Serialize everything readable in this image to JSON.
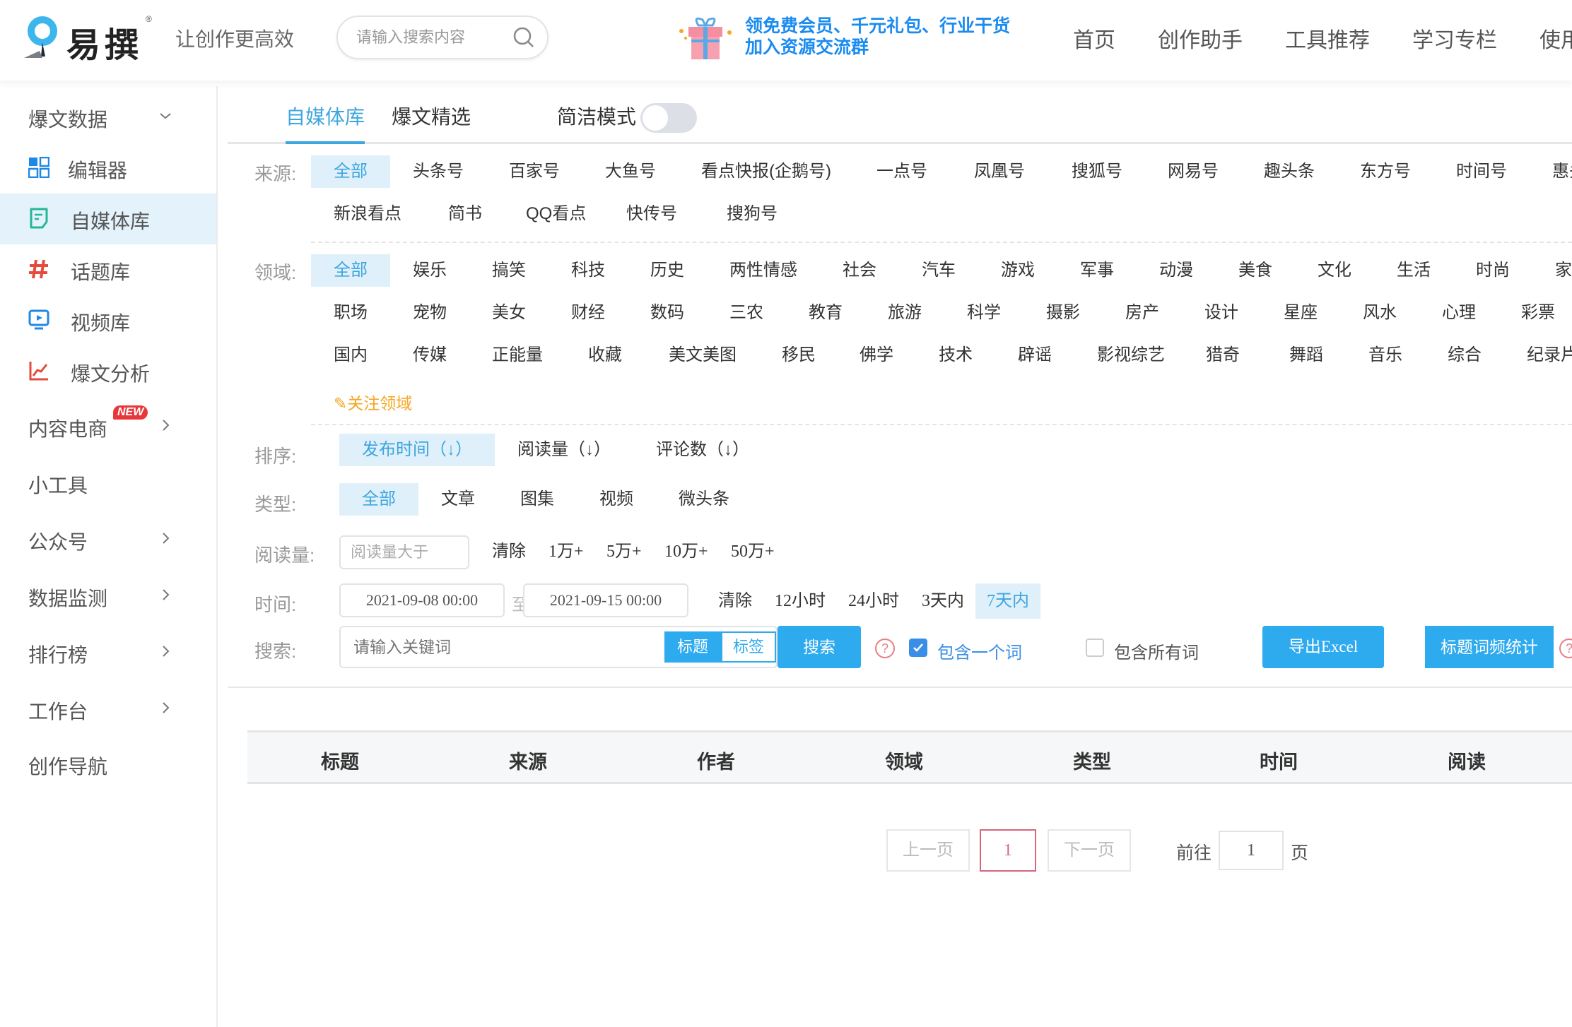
{
  "header": {
    "logo_text": "易撰",
    "logo_reg": "®",
    "slogan": "让创作更高效",
    "search_placeholder": "请输入搜索内容",
    "promo_line1": "领免费会员、千元礼包、行业干货",
    "promo_line2": "加入资源交流群",
    "nav": [
      "首页",
      "创作助手",
      "工具推荐",
      "学习专栏",
      "使用"
    ]
  },
  "sidebar": {
    "section_title": "爆文数据",
    "items": [
      {
        "label": "编辑器",
        "icon": "grid-icon"
      },
      {
        "label": "自媒体库",
        "icon": "note-icon",
        "active": true
      },
      {
        "label": "话题库",
        "icon": "hashtag-icon"
      },
      {
        "label": "视频库",
        "icon": "video-icon"
      },
      {
        "label": "爆文分析",
        "icon": "chart-line-icon"
      }
    ],
    "groups": [
      {
        "label": "内容电商",
        "badge": "NEW",
        "has_arrow": true
      },
      {
        "label": "小工具",
        "has_arrow": false
      },
      {
        "label": "公众号",
        "has_arrow": true
      },
      {
        "label": "数据监测",
        "has_arrow": true
      },
      {
        "label": "排行榜",
        "has_arrow": true
      },
      {
        "label": "工作台",
        "has_arrow": true
      },
      {
        "label": "创作导航",
        "has_arrow": false
      }
    ]
  },
  "tabs": {
    "items": [
      "自媒体库",
      "爆文精选"
    ],
    "active": "自媒体库",
    "simple_mode_label": "简洁模式",
    "simple_mode_on": false
  },
  "filters": {
    "source": {
      "label": "来源:",
      "selected": "全部",
      "row1": [
        "全部",
        "头条号",
        "百家号",
        "大鱼号",
        "看点快报(企鹅号)",
        "一点号",
        "凤凰号",
        "搜狐号",
        "网易号",
        "趣头条",
        "东方号",
        "时间号",
        "惠头"
      ],
      "row2": [
        "新浪看点",
        "简书",
        "QQ看点",
        "快传号",
        "搜狗号"
      ]
    },
    "domain": {
      "label": "领域:",
      "selected": "全部",
      "row1": [
        "全部",
        "娱乐",
        "搞笑",
        "科技",
        "历史",
        "两性情感",
        "社会",
        "汽车",
        "游戏",
        "军事",
        "动漫",
        "美食",
        "文化",
        "生活",
        "时尚",
        "家"
      ],
      "row2": [
        "职场",
        "宠物",
        "美女",
        "财经",
        "数码",
        "三农",
        "教育",
        "旅游",
        "科学",
        "摄影",
        "房产",
        "设计",
        "星座",
        "风水",
        "心理",
        "彩票"
      ],
      "row3": [
        "国内",
        "传媒",
        "正能量",
        "收藏",
        "美文美图",
        "移民",
        "佛学",
        "技术",
        "辟谣",
        "影视综艺",
        "猎奇",
        "舞蹈",
        "音乐",
        "综合",
        "纪录片"
      ],
      "follow_label": "关注领域"
    },
    "sort": {
      "label": "排序:",
      "options": [
        "发布时间（↓）",
        "阅读量（↓）",
        "评论数（↓）"
      ],
      "selected": "发布时间（↓）"
    },
    "type": {
      "label": "类型:",
      "options": [
        "全部",
        "文章",
        "图集",
        "视频",
        "微头条"
      ],
      "selected": "全部"
    },
    "reads": {
      "label": "阅读量:",
      "placeholder": "阅读量大于",
      "options": [
        "清除",
        "1万+",
        "5万+",
        "10万+",
        "50万+"
      ]
    },
    "time": {
      "label": "时间:",
      "start": "2021-09-08 00:00",
      "to": "至",
      "end": "2021-09-15 00:00",
      "options": [
        "清除",
        "12小时",
        "24小时",
        "3天内",
        "7天内"
      ],
      "selected": "7天内"
    },
    "search": {
      "label": "搜索:",
      "placeholder": "请输入关键词",
      "scope_options": [
        "标题",
        "标签"
      ],
      "scope_selected": "标题",
      "search_button": "搜索",
      "help": "?",
      "match_one_label": "包含一个词",
      "match_one_checked": true,
      "match_all_label": "包含所有词",
      "match_all_checked": false,
      "export_button": "导出Excel",
      "wordfreq_button": "标题词频统计"
    }
  },
  "table": {
    "columns": [
      "标题",
      "来源",
      "作者",
      "领域",
      "类型",
      "时间",
      "阅读"
    ],
    "rows": []
  },
  "pagination": {
    "prev": "上一页",
    "current": "1",
    "next": "下一页",
    "goto_label": "前往",
    "goto_value": "1",
    "page_suffix": "页"
  },
  "colors": {
    "accent": "#3ea6de",
    "button": "#2eaaef",
    "selected_bg": "#dff0fb",
    "current_page": "#d6657e",
    "follow": "#f5a623"
  }
}
